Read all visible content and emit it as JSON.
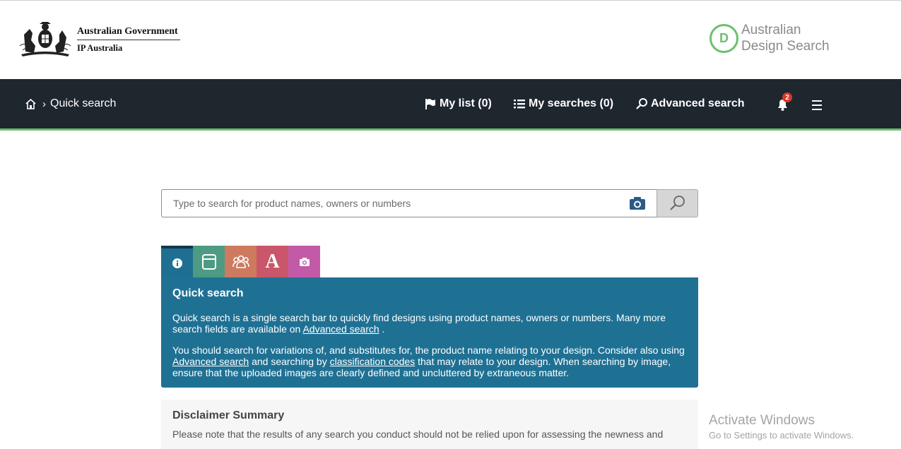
{
  "header": {
    "gov_line1": "Australian Government",
    "gov_line2": "IP Australia",
    "app_logo_letter": "D",
    "app_name_line1": "Australian",
    "app_name_line2": "Design Search"
  },
  "nav": {
    "breadcrumb_icon": "home-icon",
    "breadcrumb_separator": "›",
    "breadcrumb_current": "Quick search",
    "my_list": "My list (0)",
    "my_searches": "My searches (0)",
    "advanced_search": "Advanced search",
    "notifications_count": "2"
  },
  "search": {
    "placeholder": "Type to search for product names, owners or numbers"
  },
  "tabs": [
    {
      "name": "info-tab",
      "icon": "info-icon"
    },
    {
      "name": "product-tab",
      "icon": "product-icon"
    },
    {
      "name": "owners-tab",
      "icon": "people-icon"
    },
    {
      "name": "text-tab",
      "icon": "text-icon",
      "label": "A"
    },
    {
      "name": "image-tab",
      "icon": "camera-icon"
    }
  ],
  "info_panel": {
    "title": "Quick search",
    "p1_text": "Quick search is a single search bar to quickly find designs using product names, owners or numbers. Many more search fields are available on",
    "p1_link": "Advanced search",
    "p1_end": ".",
    "p2_text1": "You should search for variations of, and substitutes for, the product name relating to your design. Consider also using",
    "p2_link1": "Advanced search",
    "p2_text2": "and searching by",
    "p2_link2": "classification codes",
    "p2_text3": "that may relate to your design. When searching by image, ensure that the uploaded images are clearly defined and uncluttered by extraneous matter."
  },
  "disclaimer": {
    "title": "Disclaimer Summary",
    "text": "Please note that the results of any search you conduct should not be relied upon for assessing the newness and"
  },
  "watermark": {
    "line1": "Activate Windows",
    "line2": "Go to Settings to activate Windows."
  },
  "colors": {
    "navbar": "#1e262e",
    "accent_green": "#6cc06e",
    "info_panel": "#1f7194",
    "tab_product": "#4d9b82",
    "tab_owners": "#cd7a5f",
    "tab_text": "#c9566a",
    "tab_image": "#c35aa7",
    "badge": "#d73a2a"
  }
}
